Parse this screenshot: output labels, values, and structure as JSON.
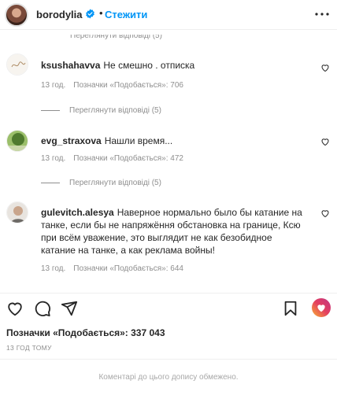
{
  "header": {
    "username": "borodylia",
    "separator": "•",
    "follow_label": "Стежити"
  },
  "cut_replies_label": "Переглянути відповіді (5)",
  "comments": [
    {
      "username": "ksushahavva",
      "text": "Не смешно . отписка",
      "time": "13 год.",
      "likes": "Позначки «Подобається»: 706",
      "replies": "Переглянути відповіді (5)"
    },
    {
      "username": "evg_straxova",
      "text": "Нашли время...",
      "time": "13 год.",
      "likes": "Позначки «Подобається»: 472",
      "replies": "Переглянути відповіді (5)"
    },
    {
      "username": "gulevitch.alesya",
      "text": "Наверное нормально было бы катание на танке, если бы не напряжёння обстановка на границе, Ксю при всём уважение, это выглядит не как безобидное катание на танке, а как реклама войны!",
      "time": "13 год.",
      "likes": "Позначки «Подобається»: 644"
    }
  ],
  "post": {
    "likes": "Позначки «Подобається»: 337 043",
    "time_ago": "13 ГОД ТОМУ",
    "comments_restricted": "Коментарі до цього допису обмежено."
  },
  "colors": {
    "accent": "#0095f6",
    "text": "#262626",
    "secondary": "#8e8e8e"
  }
}
